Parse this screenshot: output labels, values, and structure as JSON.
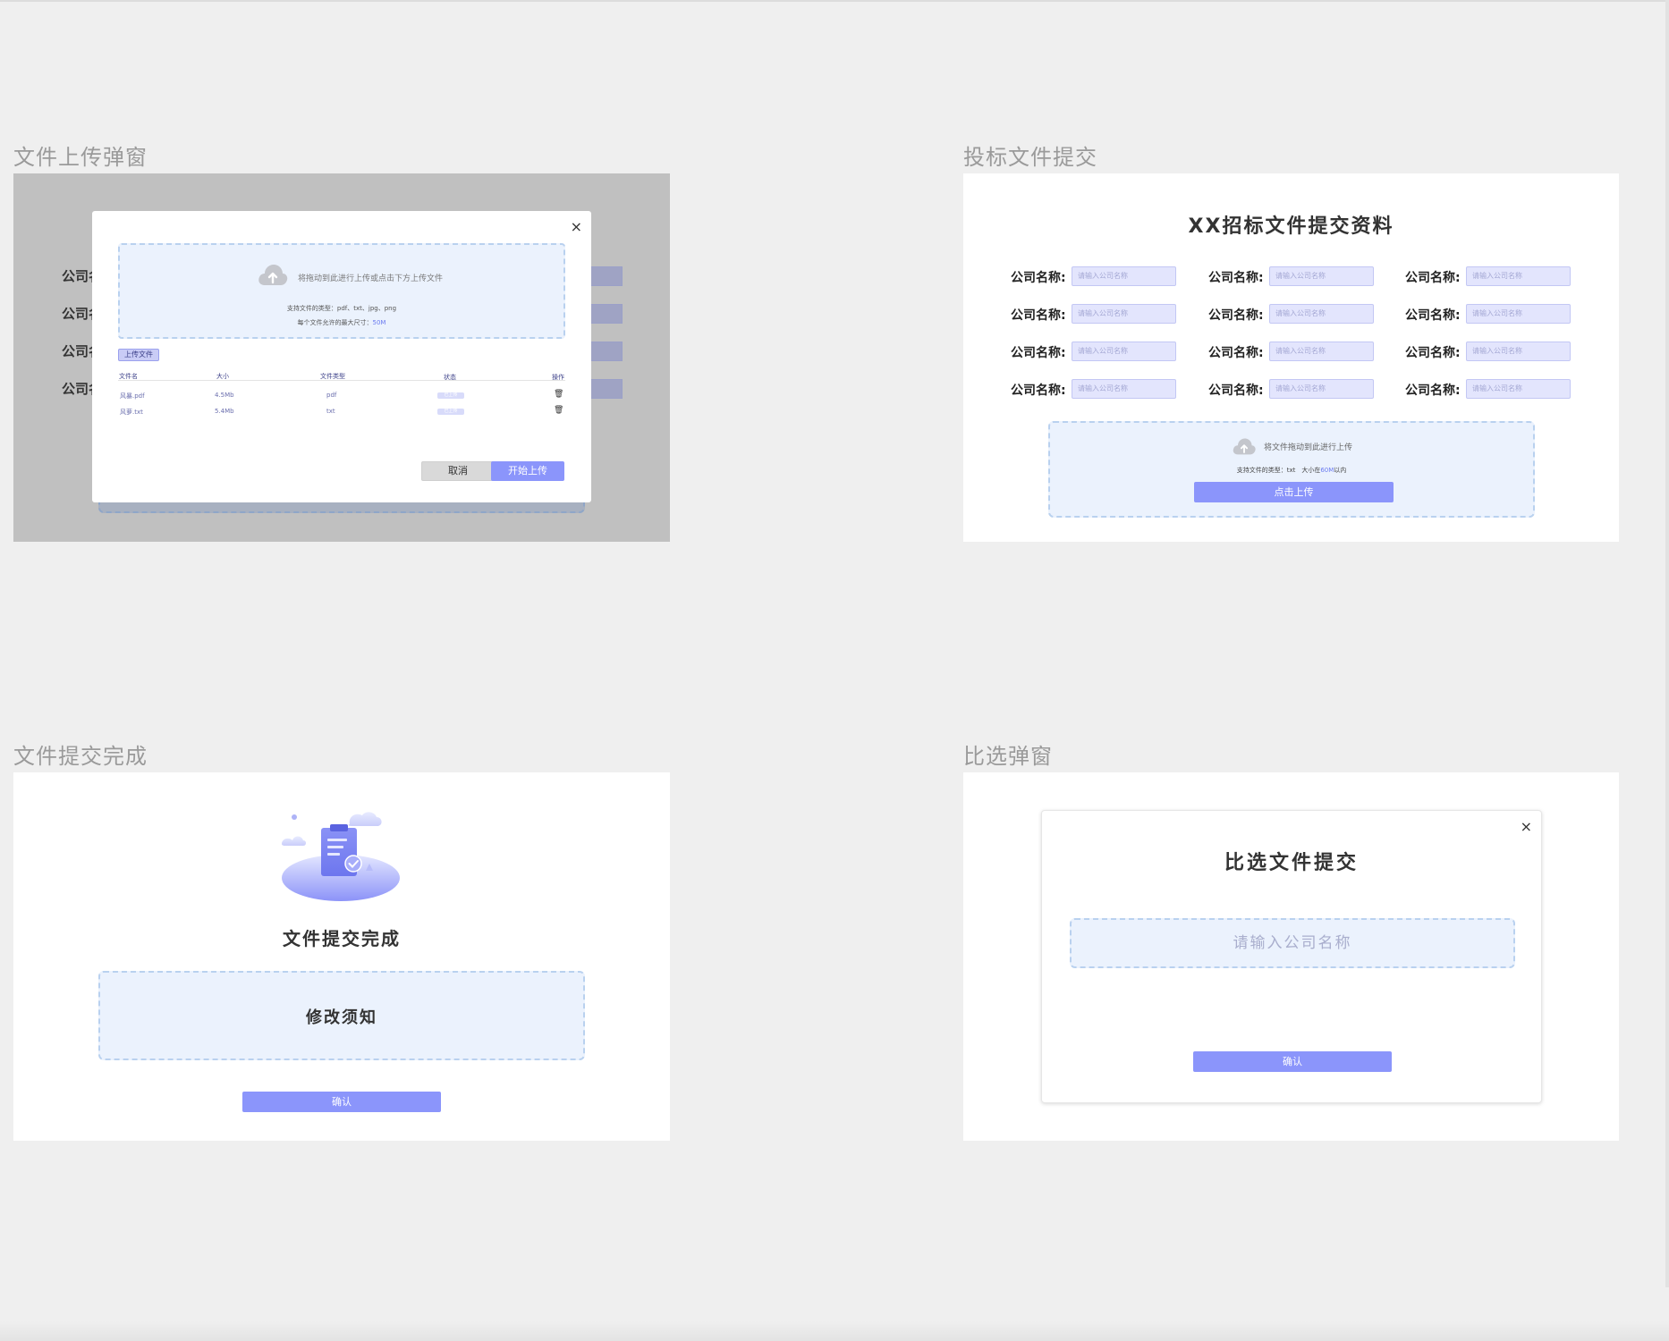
{
  "frames": {
    "upload_modal": {
      "label": "文件上传弹窗",
      "background_label": "公司名",
      "modal": {
        "close": "×",
        "drop_text": "将拖动到此进行上传或点击下方上传文件",
        "supported_types": "支持文件的类型：pdf、txt、jpg、png",
        "max_size_prefix": "每个文件允许的最大尺寸：",
        "max_size_value": "50M",
        "upload_tag": "上传文件",
        "table": {
          "headers": [
            "文件名",
            "大小",
            "文件类型",
            "状态",
            "操作"
          ],
          "rows": [
            {
              "name": "风暴.pdf",
              "size": "4.5Mb",
              "type": "pdf",
              "status": "已上传"
            },
            {
              "name": "风萝.txt",
              "size": "5.4Mb",
              "type": "txt",
              "status": "已上传"
            }
          ]
        },
        "cancel": "取消",
        "start": "开始上传"
      }
    },
    "bid_submission": {
      "label": "投标文件提交",
      "title": "XX招标文件提交资料",
      "field_label": "公司名称:",
      "field_placeholder": "请输入公司名称",
      "drop_text": "将文件拖动到此进行上传",
      "supported_types_prefix": "支持文件的类型：txt　大小在",
      "size_value": "60M",
      "size_suffix": "以内",
      "upload_button": "点击上传"
    },
    "submit_complete": {
      "label": "文件提交完成",
      "title": "文件提交完成",
      "notice": "修改须知",
      "confirm": "确认"
    },
    "comparison_modal": {
      "label": "比选弹窗",
      "close": "×",
      "title": "比选文件提交",
      "input_placeholder": "请输入公司名称",
      "confirm": "确认"
    }
  },
  "colors": {
    "accent": "#8b95fb",
    "dropzone_bg": "#ebf2fd",
    "dropzone_border": "#b9d1ef",
    "input_bg": "#e3e5fd",
    "page_bg": "#efefef"
  },
  "icons": [
    "upload-cloud-icon",
    "close-icon",
    "trash-icon",
    "clipboard-check-illustration"
  ]
}
